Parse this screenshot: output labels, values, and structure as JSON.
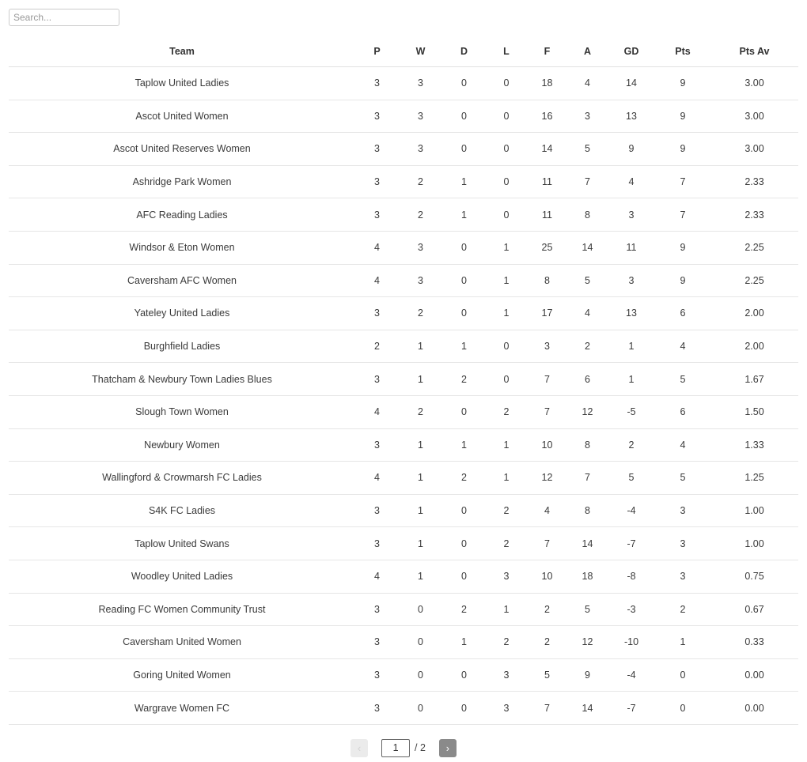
{
  "search": {
    "placeholder": "Search...",
    "value": ""
  },
  "table": {
    "columns": [
      {
        "key": "team",
        "label": "Team"
      },
      {
        "key": "p",
        "label": "P"
      },
      {
        "key": "w",
        "label": "W"
      },
      {
        "key": "d",
        "label": "D"
      },
      {
        "key": "l",
        "label": "L"
      },
      {
        "key": "f",
        "label": "F"
      },
      {
        "key": "a",
        "label": "A"
      },
      {
        "key": "gd",
        "label": "GD"
      },
      {
        "key": "pts",
        "label": "Pts"
      },
      {
        "key": "ptsav",
        "label": "Pts Av"
      }
    ],
    "rows": [
      {
        "team": "Taplow United Ladies",
        "p": "3",
        "w": "3",
        "d": "0",
        "l": "0",
        "f": "18",
        "a": "4",
        "gd": "14",
        "pts": "9",
        "ptsav": "3.00"
      },
      {
        "team": "Ascot United Women",
        "p": "3",
        "w": "3",
        "d": "0",
        "l": "0",
        "f": "16",
        "a": "3",
        "gd": "13",
        "pts": "9",
        "ptsav": "3.00"
      },
      {
        "team": "Ascot United Reserves Women",
        "p": "3",
        "w": "3",
        "d": "0",
        "l": "0",
        "f": "14",
        "a": "5",
        "gd": "9",
        "pts": "9",
        "ptsav": "3.00"
      },
      {
        "team": "Ashridge Park Women",
        "p": "3",
        "w": "2",
        "d": "1",
        "l": "0",
        "f": "11",
        "a": "7",
        "gd": "4",
        "pts": "7",
        "ptsav": "2.33"
      },
      {
        "team": "AFC Reading Ladies",
        "p": "3",
        "w": "2",
        "d": "1",
        "l": "0",
        "f": "11",
        "a": "8",
        "gd": "3",
        "pts": "7",
        "ptsav": "2.33"
      },
      {
        "team": "Windsor & Eton Women",
        "p": "4",
        "w": "3",
        "d": "0",
        "l": "1",
        "f": "25",
        "a": "14",
        "gd": "11",
        "pts": "9",
        "ptsav": "2.25"
      },
      {
        "team": "Caversham AFC Women",
        "p": "4",
        "w": "3",
        "d": "0",
        "l": "1",
        "f": "8",
        "a": "5",
        "gd": "3",
        "pts": "9",
        "ptsav": "2.25"
      },
      {
        "team": "Yateley United Ladies",
        "p": "3",
        "w": "2",
        "d": "0",
        "l": "1",
        "f": "17",
        "a": "4",
        "gd": "13",
        "pts": "6",
        "ptsav": "2.00"
      },
      {
        "team": "Burghfield Ladies",
        "p": "2",
        "w": "1",
        "d": "1",
        "l": "0",
        "f": "3",
        "a": "2",
        "gd": "1",
        "pts": "4",
        "ptsav": "2.00"
      },
      {
        "team": "Thatcham & Newbury Town Ladies Blues",
        "p": "3",
        "w": "1",
        "d": "2",
        "l": "0",
        "f": "7",
        "a": "6",
        "gd": "1",
        "pts": "5",
        "ptsav": "1.67"
      },
      {
        "team": "Slough Town Women",
        "p": "4",
        "w": "2",
        "d": "0",
        "l": "2",
        "f": "7",
        "a": "12",
        "gd": "-5",
        "pts": "6",
        "ptsav": "1.50"
      },
      {
        "team": "Newbury Women",
        "p": "3",
        "w": "1",
        "d": "1",
        "l": "1",
        "f": "10",
        "a": "8",
        "gd": "2",
        "pts": "4",
        "ptsav": "1.33"
      },
      {
        "team": "Wallingford & Crowmarsh FC Ladies",
        "p": "4",
        "w": "1",
        "d": "2",
        "l": "1",
        "f": "12",
        "a": "7",
        "gd": "5",
        "pts": "5",
        "ptsav": "1.25"
      },
      {
        "team": "S4K FC Ladies",
        "p": "3",
        "w": "1",
        "d": "0",
        "l": "2",
        "f": "4",
        "a": "8",
        "gd": "-4",
        "pts": "3",
        "ptsav": "1.00"
      },
      {
        "team": "Taplow United Swans",
        "p": "3",
        "w": "1",
        "d": "0",
        "l": "2",
        "f": "7",
        "a": "14",
        "gd": "-7",
        "pts": "3",
        "ptsav": "1.00"
      },
      {
        "team": "Woodley United Ladies",
        "p": "4",
        "w": "1",
        "d": "0",
        "l": "3",
        "f": "10",
        "a": "18",
        "gd": "-8",
        "pts": "3",
        "ptsav": "0.75"
      },
      {
        "team": "Reading FC Women Community Trust",
        "p": "3",
        "w": "0",
        "d": "2",
        "l": "1",
        "f": "2",
        "a": "5",
        "gd": "-3",
        "pts": "2",
        "ptsav": "0.67"
      },
      {
        "team": "Caversham United Women",
        "p": "3",
        "w": "0",
        "d": "1",
        "l": "2",
        "f": "2",
        "a": "12",
        "gd": "-10",
        "pts": "1",
        "ptsav": "0.33"
      },
      {
        "team": "Goring United Women",
        "p": "3",
        "w": "0",
        "d": "0",
        "l": "3",
        "f": "5",
        "a": "9",
        "gd": "-4",
        "pts": "0",
        "ptsav": "0.00"
      },
      {
        "team": "Wargrave Women FC",
        "p": "3",
        "w": "0",
        "d": "0",
        "l": "3",
        "f": "7",
        "a": "14",
        "gd": "-7",
        "pts": "0",
        "ptsav": "0.00"
      }
    ]
  },
  "pagination": {
    "prev_label": "‹",
    "next_label": "›",
    "current_page": "1",
    "total_pages_label": "/ 2",
    "colors": {
      "prev_bg": "#ebebeb",
      "prev_fg": "#d2d2d2",
      "next_bg": "#8a8a8a",
      "next_fg": "#ffffff"
    }
  }
}
